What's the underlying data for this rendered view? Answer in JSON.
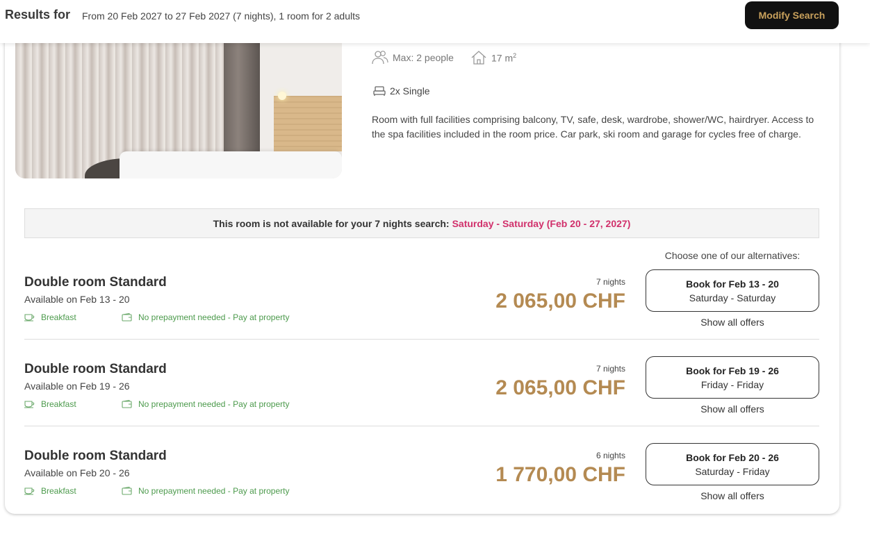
{
  "header": {
    "results_label": "Results for",
    "search_summary": "From 20 Feb 2027 to 27 Feb 2027 (7 nights), 1 room for 2 adults",
    "modify_button": "Modify Search"
  },
  "room": {
    "max_people": "Max: 2 people",
    "size": "17 m",
    "size_sup": "2",
    "beds": "2x Single",
    "description": "Room with full facilities comprising balcony, TV, safe, desk, wardrobe, shower/WC, hairdryer. Access to the spa facilities included in the room price. Car park, ski room and garage for cycles free of charge."
  },
  "notice": {
    "text": "This room is not available for your 7 nights search:",
    "highlight": "Saturday - Saturday (Feb 20 - 27, 2027)"
  },
  "alternatives_label": "Choose one of our alternatives:",
  "offers": [
    {
      "name": "Double room Standard",
      "available": "Available on Feb 13 - 20",
      "breakfast": "Breakfast",
      "prepayment": "No prepayment needed - Pay at property",
      "nights": "7 nights",
      "price": "2 065,00 CHF",
      "book_line1": "Book for Feb 13 - 20",
      "book_line2": "Saturday - Saturday",
      "show_all": "Show all offers"
    },
    {
      "name": "Double room Standard",
      "available": "Available on Feb 19 - 26",
      "breakfast": "Breakfast",
      "prepayment": "No prepayment needed - Pay at property",
      "nights": "7 nights",
      "price": "2 065,00 CHF",
      "book_line1": "Book for Feb 19 - 26",
      "book_line2": "Friday - Friday",
      "show_all": "Show all offers"
    },
    {
      "name": "Double room Standard",
      "available": "Available on Feb 20 - 26",
      "breakfast": "Breakfast",
      "prepayment": "No prepayment needed - Pay at property",
      "nights": "6 nights",
      "price": "1 770,00 CHF",
      "book_line1": "Book for Feb 20 - 26",
      "book_line2": "Saturday - Friday",
      "show_all": "Show all offers"
    }
  ],
  "colors": {
    "price": "#b48a52",
    "highlight": "#d1306b",
    "feature_green": "#4c9a4c",
    "button_dark": "#111111",
    "button_text_gold": "#c9a15c"
  }
}
